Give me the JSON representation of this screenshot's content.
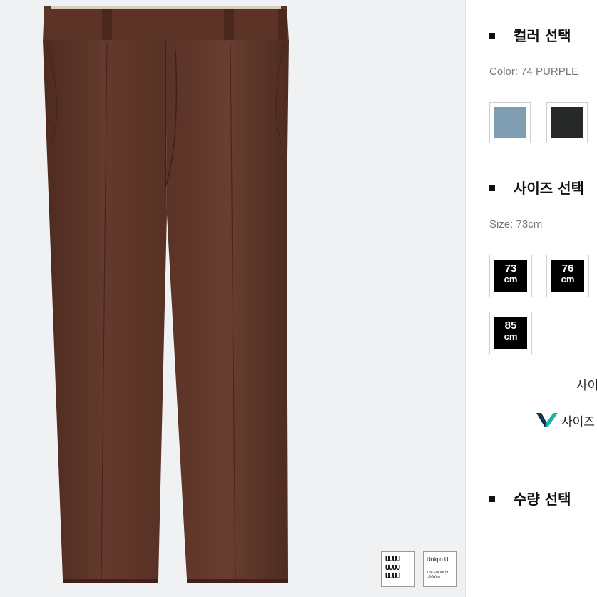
{
  "product": {
    "image_alt": "brown straight trousers",
    "color_hex": "#5b3327",
    "logos": {
      "uuuu_text": "UUUU\nUUUU\nUUUU",
      "uniqlo_title": "Uniqlo U",
      "uniqlo_sub": "The Future of LifeWear"
    }
  },
  "options": {
    "color_section": {
      "title": "컬러 선택",
      "selected_label": "Color: 74 PURPLE",
      "swatches": [
        {
          "name": "light-blue",
          "hex": "#7f9db0"
        },
        {
          "name": "black",
          "hex": "#262828"
        }
      ]
    },
    "size_section": {
      "title": "사이즈 선택",
      "selected_label": "Size: 73cm",
      "sizes": [
        {
          "num": "73",
          "unit": "cm"
        },
        {
          "num": "76",
          "unit": "cm"
        },
        {
          "num": "85",
          "unit": "cm"
        }
      ],
      "link_top": "사이",
      "link_bottom": "사이즈",
      "accent_hex": "#14b3a8"
    },
    "quantity_section": {
      "title": "수량 선택"
    }
  }
}
